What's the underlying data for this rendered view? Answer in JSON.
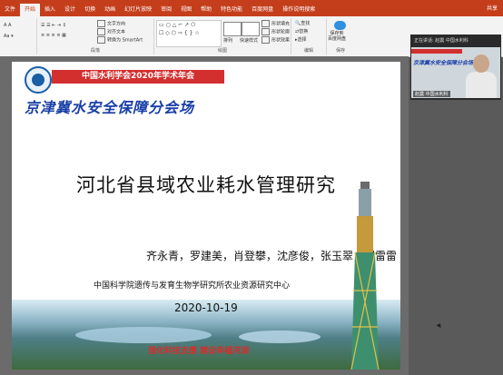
{
  "ribbon": {
    "tabs": [
      "文件",
      "开始",
      "插入",
      "设计",
      "切换",
      "动画",
      "幻灯片放映",
      "审阅",
      "视图",
      "帮助",
      "特色功能",
      "百度网盘",
      "操作说明搜索"
    ],
    "active_tab": "开始",
    "share_label": "共享",
    "groups": {
      "paragraph": "段落",
      "drawing": "绘图",
      "editing": "编辑",
      "save": "保存"
    },
    "text_cmds": {
      "text_direction": "文字方向",
      "align_text": "对齐文本",
      "smartart": "转换为 SmartArt",
      "arrange": "排列",
      "quick_styles": "快速样式",
      "shape_fill": "形状填充",
      "shape_outline": "形状轮廓",
      "shape_effects": "形状效果",
      "find": "查找",
      "replace": "替换",
      "select": "选择",
      "save_baidu": "保存到\n百度网盘"
    },
    "colors": {
      "title_bar": "#c43e1c"
    }
  },
  "slide": {
    "conference": "中国水利学会2020年学术年会",
    "venue": "京津冀水安全保障分会场",
    "title": "河北省县域农业耗水管理研究",
    "authors": "齐永青，罗建美，肖登攀，沈彦俊，张玉翠，闵雷雷",
    "institution": "中国科学院遗传与发育生物学研究所农业资源研究中心",
    "date": "2020-10-19",
    "slogan": "强化科技支撑    建设幸福河湖",
    "colors": {
      "accent": "#d32f2f",
      "venue_text": "#1a3fa8"
    }
  },
  "video": {
    "header": "正在讲话: 赵震 中国水利科",
    "participant_name": "赵震  中国水利科",
    "thumb_title": "京津冀水安全保障分会场"
  }
}
